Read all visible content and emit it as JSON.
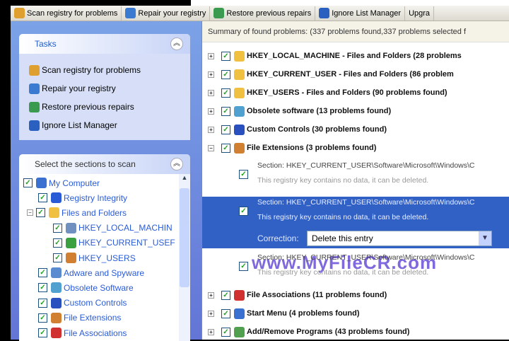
{
  "toolbar": {
    "items": [
      {
        "label": "Scan registry for problems",
        "icon": "magnifier-icon",
        "color": "#e0a030"
      },
      {
        "label": "Repair your registry",
        "icon": "repair-icon",
        "color": "#3a7ad0"
      },
      {
        "label": "Restore previous repairs",
        "icon": "restore-icon",
        "color": "#3a9a50"
      },
      {
        "label": "Ignore List Manager",
        "icon": "ignore-list-icon",
        "color": "#2a60c0"
      },
      {
        "label": "Upgra",
        "icon": "",
        "color": ""
      }
    ]
  },
  "tasks": {
    "title": "Tasks",
    "items": [
      {
        "label": "Scan registry for problems",
        "icon": "magnifier-icon",
        "color": "#e0a030"
      },
      {
        "label": "Repair your registry",
        "icon": "repair-icon",
        "color": "#3a7ad0"
      },
      {
        "label": "Restore previous repairs",
        "icon": "restore-icon",
        "color": "#3a9a50"
      },
      {
        "label": "Ignore List Manager",
        "icon": "ignore-list-icon",
        "color": "#2a60c0"
      }
    ]
  },
  "sections": {
    "title": "Select the sections to scan",
    "items": [
      {
        "label": "My Computer",
        "level": 0,
        "color": "#3a70d0"
      },
      {
        "label": "Registry Integrity",
        "level": 1,
        "color": "#2a5bd7"
      },
      {
        "label": "Files and Folders",
        "level": 1,
        "color": "#f0c040",
        "expanded": true
      },
      {
        "label": "HKEY_LOCAL_MACHIN",
        "level": 2,
        "color": "#7090c0"
      },
      {
        "label": "HKEY_CURRENT_USEF",
        "level": 2,
        "color": "#3aa040"
      },
      {
        "label": "HKEY_USERS",
        "level": 2,
        "color": "#d08030"
      },
      {
        "label": "Adware and Spyware",
        "level": 1,
        "color": "#5a8ad0"
      },
      {
        "label": "Obsolete Software",
        "level": 1,
        "color": "#50a0d0"
      },
      {
        "label": "Custom Controls",
        "level": 1,
        "color": "#2a50c0"
      },
      {
        "label": "File Extensions",
        "level": 1,
        "color": "#d08030"
      },
      {
        "label": "File Associations",
        "level": 1,
        "color": "#d03030"
      }
    ]
  },
  "main": {
    "summary": "Summary of found problems: (337 problems found,337 problems selected f",
    "categories": [
      {
        "label": "HKEY_LOCAL_MACHINE - Files and Folders  (28 problems",
        "color": "#f0c040"
      },
      {
        "label": "HKEY_CURRENT_USER - Files and Folders  (86 problem",
        "color": "#f0c040"
      },
      {
        "label": "HKEY_USERS - Files and Folders  (90 problems found)",
        "color": "#f0c040"
      },
      {
        "label": "Obsolete software  (13 problems found)",
        "color": "#50a0d0"
      },
      {
        "label": "Custom Controls  (30 problems found)",
        "color": "#2a50c0"
      },
      {
        "label": "File Extensions  (3 problems found)",
        "color": "#d08030"
      },
      {
        "label": "File Associations  (11 problems found)",
        "color": "#d03030"
      },
      {
        "label": "Start Menu  (4 problems found)",
        "color": "#3a70d0"
      },
      {
        "label": "Add/Remove Programs  (43 problems found)",
        "color": "#50a050"
      }
    ],
    "entries": [
      {
        "section": "Section: HKEY_CURRENT_USER\\Software\\Microsoft\\Windows\\C",
        "desc": "This registry key contains no data, it can be deleted."
      },
      {
        "section": "Section: HKEY_CURRENT_USER\\Software\\Microsoft\\Windows\\C",
        "desc": "This registry key contains no data, it can be deleted.",
        "selected": true
      },
      {
        "section": "Section: HKEY_CURRENT_USER\\Software\\Microsoft\\Windows\\C",
        "desc": "This registry key contains no data, it can be deleted."
      }
    ],
    "correction_label": "Correction:",
    "correction_value": "Delete this entry"
  },
  "watermark": "www.MyFileCR.com"
}
